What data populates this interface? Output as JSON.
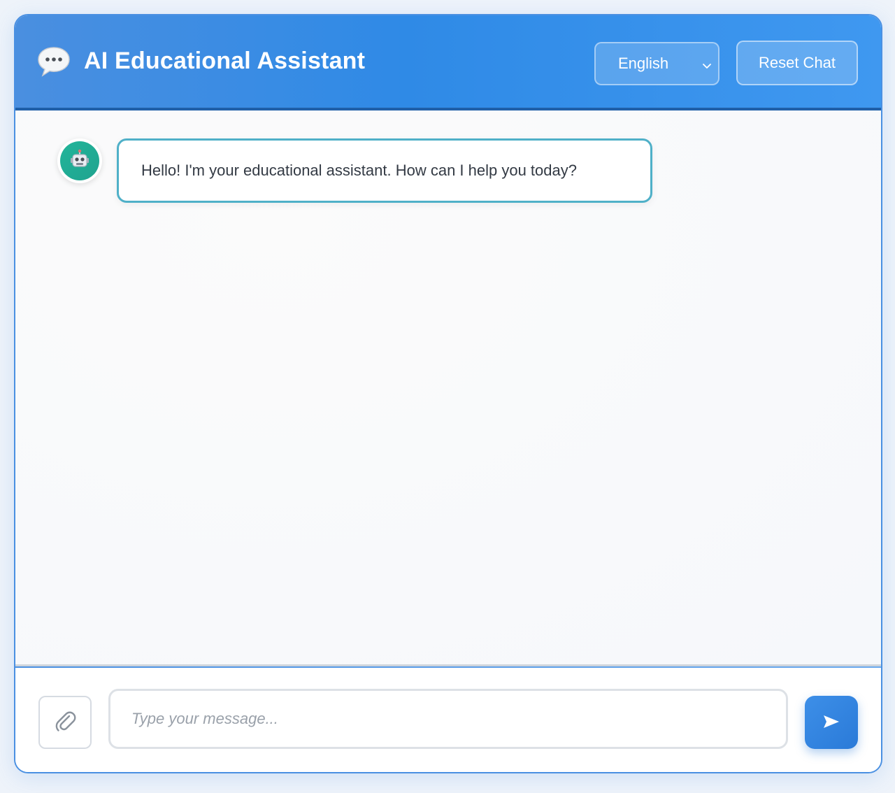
{
  "header": {
    "icon": "speech-balloon-icon",
    "title": "AI Educational Assistant",
    "language_selected": "English",
    "reset_label": "Reset Chat"
  },
  "chat": {
    "messages": [
      {
        "sender": "bot",
        "avatar_icon": "robot-icon",
        "text": "Hello! I'm your educational assistant. How can I help you today?"
      }
    ]
  },
  "composer": {
    "attach_icon": "paperclip-icon",
    "placeholder": "Type your message...",
    "value": "",
    "send_icon": "send-arrow-icon"
  },
  "colors": {
    "header_gradient_start": "#4a8fe0",
    "header_gradient_end": "#3f98f0",
    "accent": "#2f8ae6",
    "bot_bubble_border": "#4fb0c8",
    "bot_avatar": "#22b59a"
  }
}
